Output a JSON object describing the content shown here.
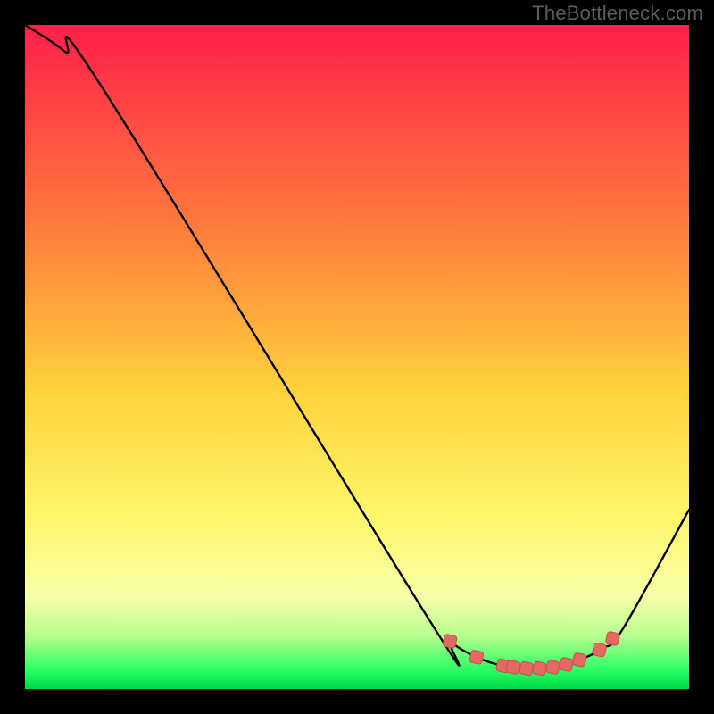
{
  "watermark": "TheBottleneck.com",
  "colors": {
    "frame": "#000000",
    "grad_top": "#ff1f4b",
    "grad_mid_upper": "#ff7a3c",
    "grad_mid": "#ffd23c",
    "grad_mid_lower": "#fff66a",
    "grad_lower_pale": "#f8ffa8",
    "grad_green_soft": "#b7ff8f",
    "grad_green": "#2eff64",
    "grad_green_deep": "#00d848",
    "curve": "#000000",
    "marker_fill": "#e26a63",
    "marker_stroke": "#c94f48"
  },
  "chart_data": {
    "type": "line",
    "title": "",
    "xlabel": "",
    "ylabel": "",
    "xlim": [
      0,
      100
    ],
    "ylim": [
      0,
      100
    ],
    "grid": false,
    "curve": [
      {
        "x": 0,
        "y": 100
      },
      {
        "x": 6,
        "y": 96
      },
      {
        "x": 12,
        "y": 90
      },
      {
        "x": 60.5,
        "y": 11
      },
      {
        "x": 64,
        "y": 7.2
      },
      {
        "x": 68,
        "y": 4.8
      },
      {
        "x": 72,
        "y": 3.5
      },
      {
        "x": 76,
        "y": 3.1
      },
      {
        "x": 80,
        "y": 3.4
      },
      {
        "x": 84,
        "y": 4.6
      },
      {
        "x": 87,
        "y": 6.2
      },
      {
        "x": 90,
        "y": 9.0
      },
      {
        "x": 100,
        "y": 27
      }
    ],
    "markers": [
      {
        "x": 64,
        "y": 7.2
      },
      {
        "x": 68,
        "y": 4.8
      },
      {
        "x": 72,
        "y": 3.5
      },
      {
        "x": 73.5,
        "y": 3.3
      },
      {
        "x": 75.5,
        "y": 3.1
      },
      {
        "x": 77.5,
        "y": 3.1
      },
      {
        "x": 79.5,
        "y": 3.3
      },
      {
        "x": 81.5,
        "y": 3.7
      },
      {
        "x": 83.5,
        "y": 4.4
      },
      {
        "x": 86.5,
        "y": 5.9
      },
      {
        "x": 88.5,
        "y": 7.6
      }
    ],
    "marker_shape": "rounded-rect",
    "marker_size_px": 14
  }
}
